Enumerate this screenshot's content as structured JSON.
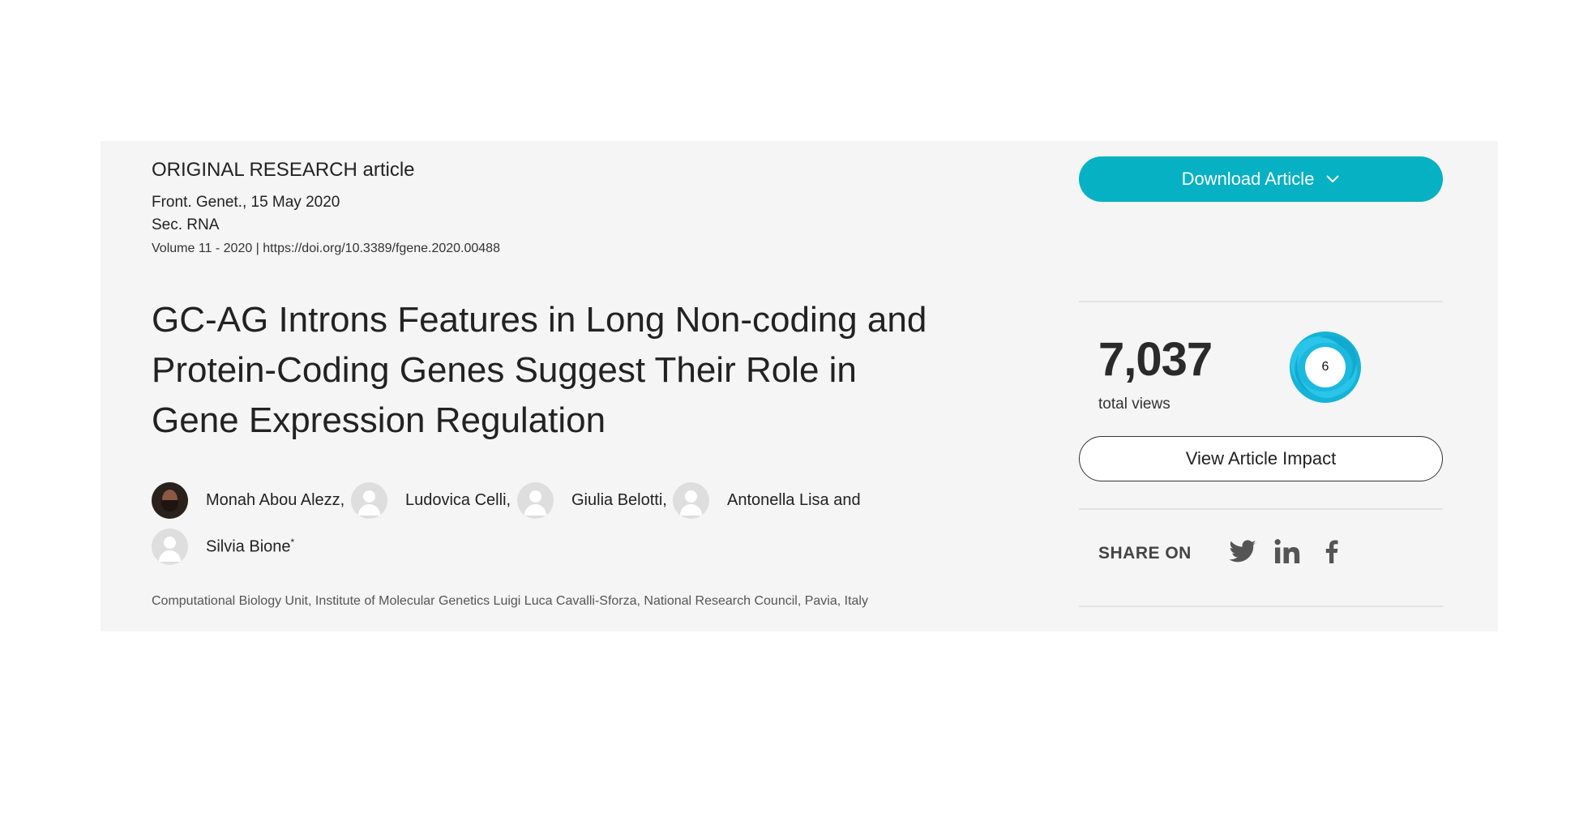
{
  "article": {
    "type": "ORIGINAL RESEARCH article",
    "journal_date": "Front. Genet., 15 May 2020",
    "section": "Sec. RNA",
    "volume": "Volume 11 - 2020 | ",
    "doi": "https://doi.org/10.3389/fgene.2020.00488",
    "title": "GC-AG Introns Features in Long Non-coding and Protein-Coding Genes Suggest Their Role in Gene Expression Regulation",
    "authors": [
      {
        "name": "Monah Abou Alezz,",
        "has_photo": true
      },
      {
        "name": "Ludovica Celli,",
        "has_photo": false
      },
      {
        "name": "Giulia Belotti,",
        "has_photo": false
      },
      {
        "name": "Antonella Lisa and",
        "has_photo": false
      },
      {
        "name": "Silvia Bione",
        "has_photo": false,
        "mark": "*"
      }
    ],
    "affiliation": "Computational Biology Unit, Institute of Molecular Genetics Luigi Luca Cavalli-Sforza, National Research Council, Pavia, Italy"
  },
  "sidebar": {
    "download_label": "Download Article",
    "views_count": "7,037",
    "views_label": "total views",
    "altmetric_score": "6",
    "impact_label": "View Article Impact",
    "share_label": "SHARE ON",
    "share_icons": [
      "twitter-icon",
      "linkedin-icon",
      "facebook-icon"
    ]
  },
  "colors": {
    "accent": "#05b1c2",
    "panel_bg": "#f5f5f5",
    "text": "#222222",
    "icon": "#555555"
  }
}
